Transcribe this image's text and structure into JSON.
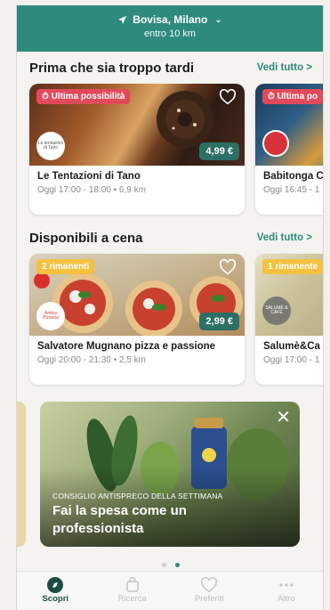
{
  "header": {
    "location": "Bovisa, Milano",
    "radius": "entro 10 km"
  },
  "sections": [
    {
      "title": "Prima che sia troppo tardi",
      "see_all": "Vedi tutto >",
      "cards": [
        {
          "badge": "⏱ Ultima possibilità",
          "badge_color": "#e24a5b",
          "logo_text": "Le tentazioni di Tano",
          "price": "4,99 €",
          "name": "Le Tentazioni di Tano",
          "time": "Oggi 17:00 - 18:00 • 6,9 km"
        },
        {
          "badge": "⏱ Ultima po",
          "badge_color": "#e24a5b",
          "name": "Babitonga C",
          "time": "Oggi 16:45 - 1"
        }
      ]
    },
    {
      "title": "Disponibili a cena",
      "see_all": "Vedi tutto >",
      "cards": [
        {
          "badge": "2 rimanenti",
          "badge_color": "#f4c141",
          "logo_text": "Antica Pizzeria",
          "price": "2,99 €",
          "name": "Salvatore Mugnano pizza e passione",
          "time": "Oggi 20:00 - 21:30 • 2,5 km"
        },
        {
          "badge": "1 rimanente",
          "badge_color": "#f4c141",
          "logo_text": "SALUMÈ & CAFÈ",
          "name": "Salumè&Ca",
          "time": "Oggi 17:00 - 1"
        }
      ]
    }
  ],
  "promo": {
    "kicker": "CONSIGLIO ANTISPRECO DELLA SETTIMANA",
    "title": "Fai la spesa come un professionista"
  },
  "tabs": [
    {
      "label": "Scopri",
      "icon": "compass-icon",
      "active": true
    },
    {
      "label": "Ricerca",
      "icon": "bag-icon",
      "active": false
    },
    {
      "label": "Preferiti",
      "icon": "heart-icon",
      "active": false
    },
    {
      "label": "Altro",
      "icon": "more-icon",
      "active": false
    }
  ],
  "colors": {
    "brand": "#2f8a7e",
    "price_bg": "#2b6f65",
    "badge_red": "#e24a5b",
    "badge_yellow": "#f4c141"
  }
}
